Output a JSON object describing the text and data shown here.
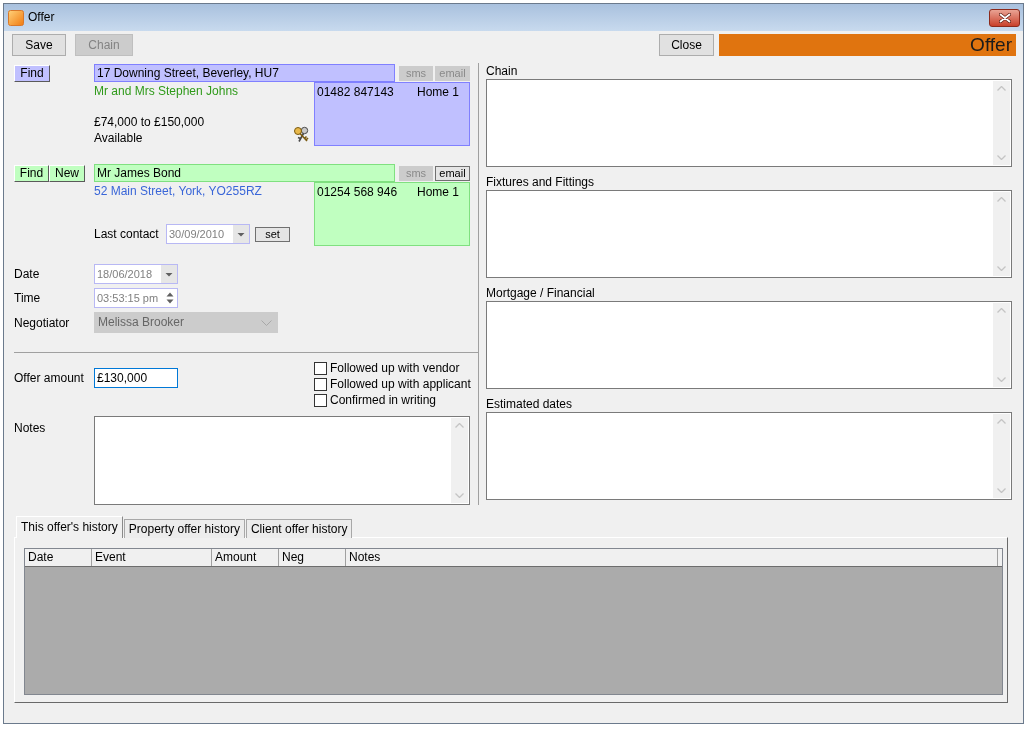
{
  "window": {
    "title": "Offer"
  },
  "toolbar": {
    "buttons": [
      {
        "label": "Save",
        "disabled": false
      },
      {
        "label": "Chain",
        "disabled": true
      }
    ],
    "close_button": "Close",
    "banner": "Offer"
  },
  "property": {
    "find_button": "Find",
    "address": "17 Downing Street, Beverley, HU7",
    "contact_buttons": [
      {
        "label": "sms",
        "disabled": true
      },
      {
        "label": "email",
        "disabled": true
      }
    ],
    "vendor": "Mr and Mrs Stephen Johns",
    "phones": [
      {
        "number": "01482 847143",
        "type": "Home 1"
      }
    ],
    "price_range": "£74,000 to £150,000",
    "status": "Available"
  },
  "applicant": {
    "buttons": [
      "Find",
      "New"
    ],
    "name": "Mr James Bond",
    "contact_buttons": [
      {
        "label": "sms",
        "disabled": true
      },
      {
        "label": "email",
        "disabled": false
      }
    ],
    "address": "52 Main Street, York, YO255RZ",
    "phones": [
      {
        "number": "01254 568 946",
        "type": "Home 1"
      }
    ],
    "last_contact": {
      "label": "Last contact",
      "value": "30/09/2010",
      "disabled": true,
      "set_button": "set"
    }
  },
  "fields": [
    {
      "kind": "date",
      "label": "Date",
      "value": "18/06/2018",
      "disabled": true
    },
    {
      "kind": "time",
      "label": "Time",
      "value": "03:53:15 pm",
      "disabled": true
    },
    {
      "kind": "select",
      "label": "Negotiator",
      "value": "Melissa Brooker",
      "disabled": true
    }
  ],
  "offer_amount": {
    "label": "Offer amount",
    "value": "£130,000",
    "focused": true
  },
  "checkboxes": [
    {
      "label": "Followed up with vendor",
      "checked": false
    },
    {
      "label": "Followed up with applicant",
      "checked": false
    },
    {
      "label": "Confirmed in writing",
      "checked": false
    }
  ],
  "notes": {
    "label": "Notes"
  },
  "sections": [
    {
      "label": "Chain"
    },
    {
      "label": "Fixtures and Fittings"
    },
    {
      "label": "Mortgage / Financial"
    },
    {
      "label": "Estimated dates"
    }
  ],
  "history": {
    "tabs": [
      {
        "label": "This offer's history",
        "selected": true
      },
      {
        "label": "Property offer history",
        "selected": false
      },
      {
        "label": "Client offer history",
        "selected": false
      }
    ],
    "columns": [
      "Date",
      "Event",
      "Amount",
      "Neg",
      "Notes"
    ]
  }
}
